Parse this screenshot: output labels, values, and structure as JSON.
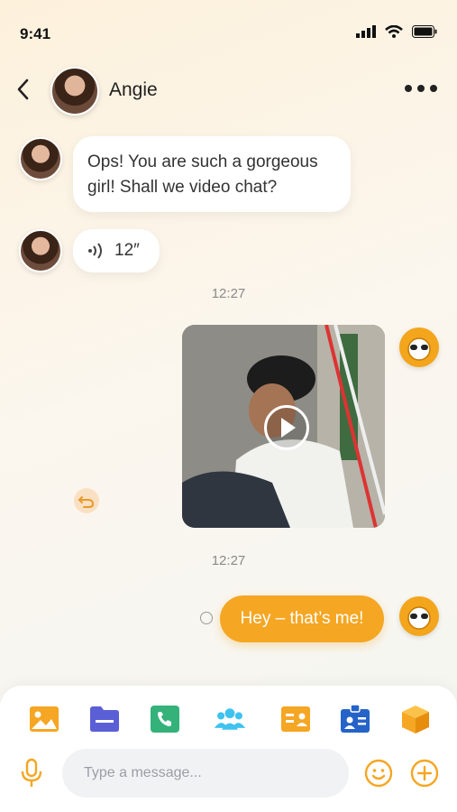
{
  "status_bar": {
    "time": "9:41"
  },
  "header": {
    "contact_name": "Angie"
  },
  "messages": [
    {
      "type": "text",
      "direction": "in",
      "text_line1": "Ops! You are such a gorgeous",
      "text_line2": "girl! Shall we video chat?"
    },
    {
      "type": "voice",
      "direction": "in",
      "duration": "12″"
    },
    {
      "type": "timestamp",
      "text": "12:27"
    },
    {
      "type": "video",
      "direction": "out"
    },
    {
      "type": "timestamp",
      "text": "12:27"
    },
    {
      "type": "text",
      "direction": "out",
      "text": "Hey – that’s me!"
    }
  ],
  "composer": {
    "placeholder": "Type a message...",
    "toolbar_icons": [
      "image-icon",
      "folder-icon",
      "phone-icon",
      "group-icon",
      "contact-card-icon",
      "badge-icon",
      "package-icon"
    ]
  },
  "colors": {
    "accent": "#F5A623",
    "bubble_in": "#FFFFFF"
  }
}
